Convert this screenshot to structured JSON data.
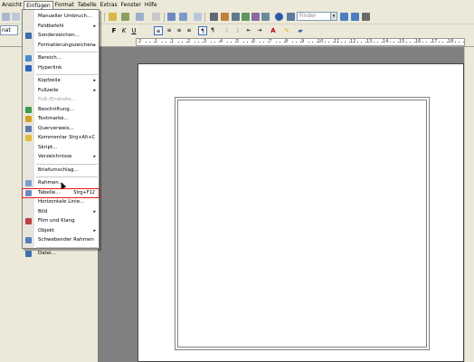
{
  "menubar": {
    "items": [
      "Ansicht",
      "Einfügen",
      "Format",
      "Tabelle",
      "Extras",
      "Fenster",
      "Hilfe"
    ],
    "active_index": 1
  },
  "toolbar": {
    "finder_placeholder": "Finder",
    "paragraph_style": "nat"
  },
  "ruler": {
    "numbers": [
      "2",
      "1",
      "1",
      "2",
      "3",
      "4",
      "5",
      "6",
      "7",
      "8",
      "9",
      "10",
      "11",
      "12",
      "13",
      "14",
      "15",
      "16",
      "17",
      "18"
    ]
  },
  "insert_menu": {
    "items": [
      {
        "label": "Manueller Umbruch...",
        "icon": "none",
        "arrow": false,
        "shortcut": ""
      },
      {
        "label": "Feldbefehl",
        "icon": "none",
        "arrow": true,
        "shortcut": ""
      },
      {
        "label": "Sonderzeichen...",
        "icon": "omega-icon",
        "arrow": false,
        "shortcut": ""
      },
      {
        "label": "Formatierungszeichen",
        "icon": "none",
        "arrow": true,
        "shortcut": ""
      },
      {
        "sep": true
      },
      {
        "label": "Bereich...",
        "icon": "section-icon",
        "arrow": false,
        "shortcut": ""
      },
      {
        "label": "Hyperlink",
        "icon": "hyperlink-icon",
        "arrow": false,
        "shortcut": ""
      },
      {
        "sep": true
      },
      {
        "label": "Kopfzeile",
        "icon": "none",
        "arrow": true,
        "shortcut": ""
      },
      {
        "label": "Fußzeile",
        "icon": "none",
        "arrow": true,
        "shortcut": ""
      },
      {
        "label": "Fuß-/Endnote...",
        "icon": "none",
        "arrow": false,
        "shortcut": "",
        "disabled": true
      },
      {
        "label": "Beschriftung...",
        "icon": "caption-icon",
        "arrow": false,
        "shortcut": ""
      },
      {
        "label": "Textmarke...",
        "icon": "bookmark-icon",
        "arrow": false,
        "shortcut": ""
      },
      {
        "label": "Querverweis...",
        "icon": "crossref-icon",
        "arrow": false,
        "shortcut": ""
      },
      {
        "label": "Kommentar",
        "icon": "comment-icon",
        "arrow": false,
        "shortcut": "Strg+Alt+C"
      },
      {
        "label": "Skript...",
        "icon": "none",
        "arrow": false,
        "shortcut": ""
      },
      {
        "label": "Verzeichnisse",
        "icon": "none",
        "arrow": true,
        "shortcut": ""
      },
      {
        "sep": true
      },
      {
        "label": "Briefumschlag...",
        "icon": "none",
        "arrow": false,
        "shortcut": ""
      },
      {
        "sep": true
      },
      {
        "label": "Rahmen...",
        "icon": "frame-icon",
        "arrow": false,
        "shortcut": ""
      },
      {
        "label": "Tabelle...",
        "icon": "table-icon",
        "arrow": false,
        "shortcut": "Strg+F12",
        "highlighted": true
      },
      {
        "label": "Horizontale Linie...",
        "icon": "none",
        "arrow": false,
        "shortcut": ""
      },
      {
        "label": "Bild",
        "icon": "none",
        "arrow": true,
        "shortcut": ""
      },
      {
        "label": "Film und Klang",
        "icon": "film-icon",
        "arrow": false,
        "shortcut": ""
      },
      {
        "label": "Objekt",
        "icon": "none",
        "arrow": true,
        "shortcut": ""
      },
      {
        "label": "Schwebender Rahmen",
        "icon": "floating-frame-icon",
        "arrow": false,
        "shortcut": ""
      },
      {
        "sep": true
      },
      {
        "label": "Datei...",
        "icon": "file-icon",
        "arrow": false,
        "shortcut": ""
      }
    ]
  },
  "icon_colors": {
    "omega-icon": "#3a6fb0",
    "section-icon": "#4a8ad0",
    "hyperlink-icon": "#2a66c0",
    "caption-icon": "#3aa04a",
    "bookmark-icon": "#d8a020",
    "crossref-icon": "#5a7ab0",
    "comment-icon": "#e0c030",
    "frame-icon": "#7aa0d0",
    "table-icon": "#6a8ac0",
    "film-icon": "#c04040",
    "floating-frame-icon": "#5080c0",
    "file-icon": "#4070b0"
  }
}
